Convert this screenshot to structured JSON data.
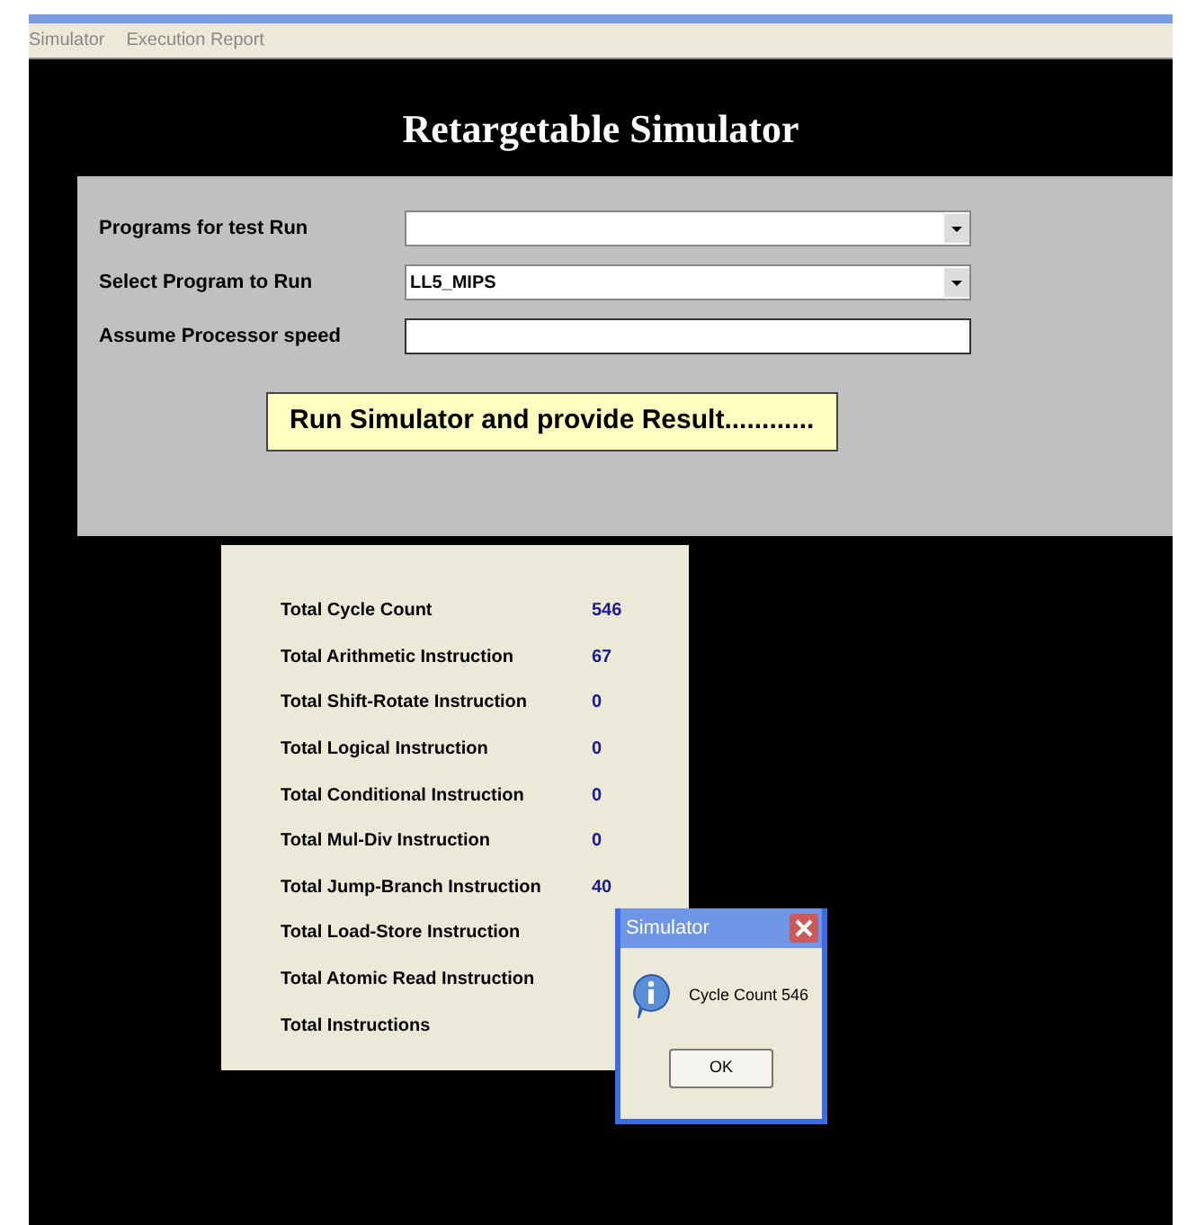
{
  "menu": [
    "Simulator",
    "Execution Report"
  ],
  "title": "Retargetable Simulator",
  "form": [
    {
      "label": "Programs for test Run",
      "kind": "dropdown"
    },
    {
      "label": "Select Program to Run",
      "kind": "dropdown",
      "value": "LL5_MIPS"
    },
    {
      "label": "Assume Processor speed",
      "kind": "text"
    }
  ],
  "run_button": "Run Simulator and provide Result............",
  "results": [
    {
      "label": "Total Cycle Count",
      "value": "546"
    },
    {
      "label": "Total Arithmetic Instruction",
      "value": "67"
    },
    {
      "label": "Total Shift-Rotate Instruction",
      "value": "0"
    },
    {
      "label": "Total Logical Instruction",
      "value": "0"
    },
    {
      "label": "Total Conditional Instruction",
      "value": "0"
    },
    {
      "label": "Total Mul-Div Instruction",
      "value": "0"
    },
    {
      "label": "Total  Jump-Branch Instruction",
      "value": "40"
    },
    {
      "label": "Total Load-Store Instruction"
    },
    {
      "label": "Total  Atomic Read Instruction"
    },
    {
      "label": "Total  Instructions"
    }
  ],
  "dialog": {
    "title": "Simulator",
    "message": "Cycle Count 546",
    "button": "OK"
  }
}
